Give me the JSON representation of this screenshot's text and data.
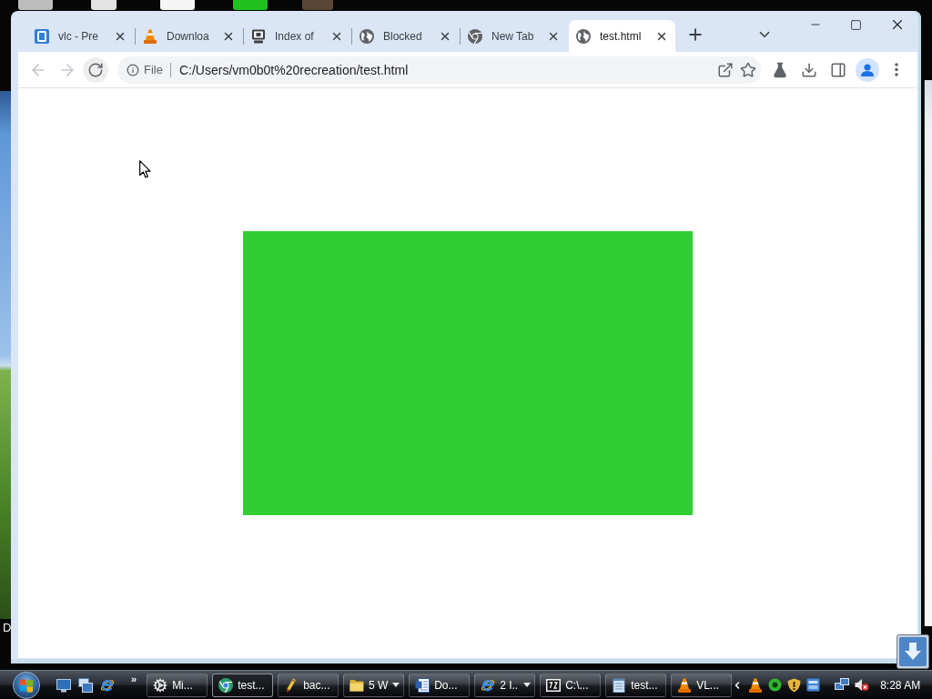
{
  "desktop": {
    "icon_labels": [
      "D"
    ]
  },
  "browser": {
    "tabs": [
      {
        "title": "vlc - Pre",
        "selected": false
      },
      {
        "title": "Downloa",
        "selected": false
      },
      {
        "title": "Index of",
        "selected": false
      },
      {
        "title": "Blocked",
        "selected": false
      },
      {
        "title": "New Tab",
        "selected": false
      },
      {
        "title": "test.html",
        "selected": true
      }
    ],
    "toolbar": {
      "back": {
        "disabled": true
      },
      "forward": {
        "disabled": true
      }
    },
    "omnibox": {
      "scheme_label": "File",
      "url": "C:/Users/vm0b0t%20recreation/test.html"
    }
  },
  "page": {
    "content": [
      {
        "kind": "rectangle"
      }
    ]
  },
  "taskbar": {
    "quick_launch_overflow": "»",
    "buttons": [
      {
        "label": "Mi...",
        "selected": false,
        "grouped": false
      },
      {
        "label": "test...",
        "selected": true,
        "grouped": false
      },
      {
        "label": "bac...",
        "selected": false,
        "grouped": false
      },
      {
        "label": "5 W",
        "selected": false,
        "grouped": true
      },
      {
        "label": "Do...",
        "selected": false,
        "grouped": false
      },
      {
        "label": "2 I..",
        "selected": false,
        "grouped": true
      },
      {
        "label": "C:\\...",
        "selected": false,
        "grouped": false
      },
      {
        "label": "test...",
        "selected": false,
        "grouped": false
      },
      {
        "label": "VL...",
        "selected": false,
        "grouped": false
      }
    ],
    "clock": "8:28 AM"
  }
}
